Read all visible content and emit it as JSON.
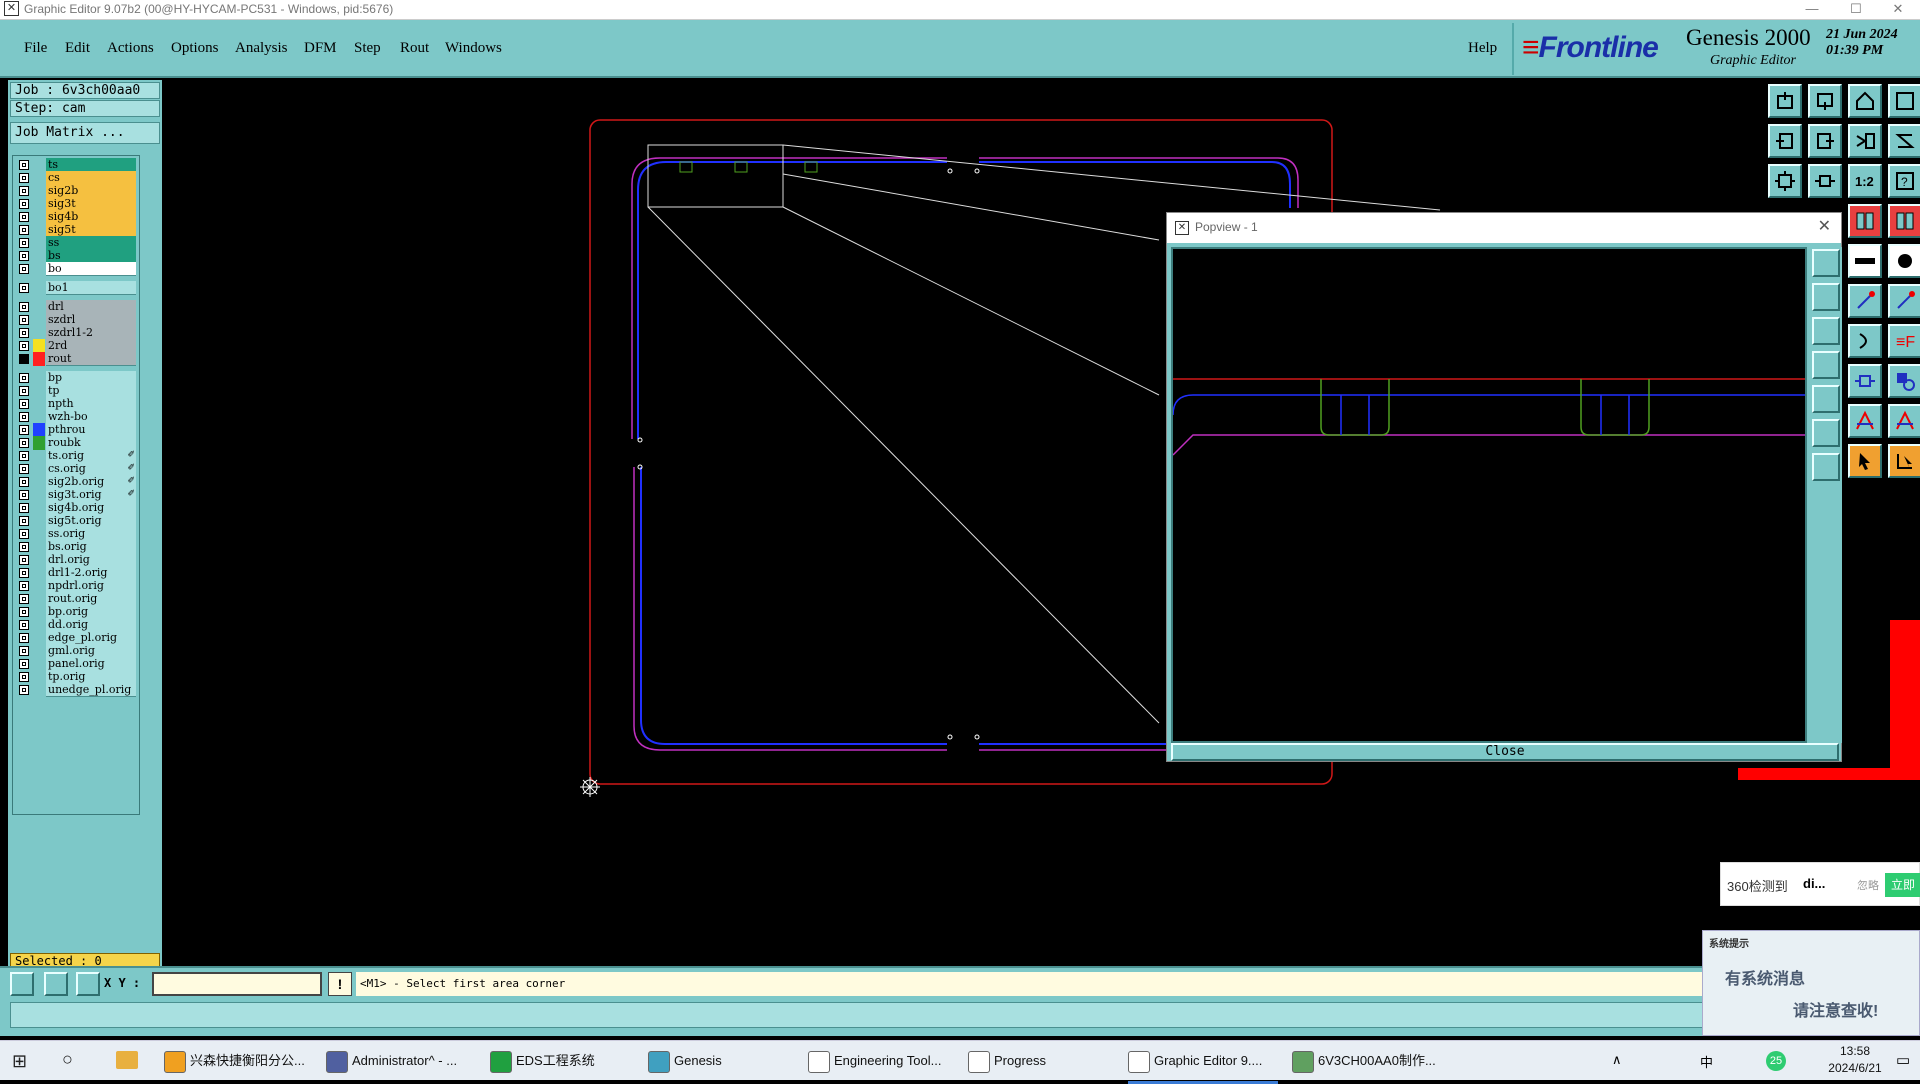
{
  "window": {
    "title": "Graphic Editor 9.07b2 (00@HY-HYCAM-PC531 - Windows, pid:5676)"
  },
  "menu": {
    "items": [
      "File",
      "Edit",
      "Actions",
      "Options",
      "Analysis",
      "DFM",
      "Step",
      "Rout",
      "Windows"
    ],
    "help": "Help"
  },
  "brand": {
    "logo": "Frontline",
    "product": "Genesis 2000",
    "subtitle": "Graphic Editor",
    "date": "21 Jun 2024",
    "time": "01:39 PM"
  },
  "job": {
    "job_label": "Job : 6v3ch00aa0",
    "step_label": "Step: cam",
    "matrix_button": "Job Matrix ..."
  },
  "layers": [
    {
      "name": "ts",
      "color": "#20a080",
      "swatch": ""
    },
    {
      "name": "cs",
      "color": "#f5c040",
      "swatch": ""
    },
    {
      "name": "sig2b",
      "color": "#f5c040",
      "swatch": ""
    },
    {
      "name": "sig3t",
      "color": "#f5c040",
      "swatch": ""
    },
    {
      "name": "sig4b",
      "color": "#f5c040",
      "swatch": ""
    },
    {
      "name": "sig5t",
      "color": "#f5c040",
      "swatch": ""
    },
    {
      "name": "ss",
      "color": "#20a080",
      "swatch": ""
    },
    {
      "name": "bs",
      "color": "#20a080",
      "swatch": ""
    },
    {
      "name": "bo",
      "color": "#ffffff",
      "swatch": ""
    },
    {
      "name": "bo1",
      "color": "#a8e0e0",
      "swatch": "",
      "gap": true
    },
    {
      "name": "drl",
      "color": "#a8b4b8",
      "swatch": "",
      "gap": true
    },
    {
      "name": "szdrl",
      "color": "#a8b4b8",
      "swatch": ""
    },
    {
      "name": "szdrl1-2",
      "color": "#a8b4b8",
      "swatch": ""
    },
    {
      "name": "2rd",
      "color": "#a8b4b8",
      "swatch": "#f5e020"
    },
    {
      "name": "rout",
      "color": "#a8b4b8",
      "swatch": "#ff2020",
      "active": true
    },
    {
      "name": "bp",
      "color": "#a8e0e0",
      "swatch": "",
      "gap": true
    },
    {
      "name": "tp",
      "color": "#a8e0e0",
      "swatch": ""
    },
    {
      "name": "npth",
      "color": "#a8e0e0",
      "swatch": ""
    },
    {
      "name": "wzh-bo",
      "color": "#a8e0e0",
      "swatch": ""
    },
    {
      "name": "pthrou",
      "color": "#a8e0e0",
      "swatch": "#2040ff"
    },
    {
      "name": "roubk",
      "color": "#a8e0e0",
      "swatch": "#30a030"
    },
    {
      "name": "ts.orig",
      "color": "#a8e0e0",
      "swatch": "",
      "mark": "✐"
    },
    {
      "name": "cs.orig",
      "color": "#a8e0e0",
      "swatch": "",
      "mark": "✐"
    },
    {
      "name": "sig2b.orig",
      "color": "#a8e0e0",
      "swatch": "",
      "mark": "✐"
    },
    {
      "name": "sig3t.orig",
      "color": "#a8e0e0",
      "swatch": "",
      "mark": "✐"
    },
    {
      "name": "sig4b.orig",
      "color": "#a8e0e0",
      "swatch": ""
    },
    {
      "name": "sig5t.orig",
      "color": "#a8e0e0",
      "swatch": ""
    },
    {
      "name": "ss.orig",
      "color": "#a8e0e0",
      "swatch": ""
    },
    {
      "name": "bs.orig",
      "color": "#a8e0e0",
      "swatch": ""
    },
    {
      "name": "drl.orig",
      "color": "#a8e0e0",
      "swatch": ""
    },
    {
      "name": "drl1-2.orig",
      "color": "#a8e0e0",
      "swatch": ""
    },
    {
      "name": "npdrl.orig",
      "color": "#a8e0e0",
      "swatch": ""
    },
    {
      "name": "rout.orig",
      "color": "#a8e0e0",
      "swatch": ""
    },
    {
      "name": "bp.orig",
      "color": "#a8e0e0",
      "swatch": ""
    },
    {
      "name": "dd.orig",
      "color": "#a8e0e0",
      "swatch": ""
    },
    {
      "name": "edge_pl.orig",
      "color": "#a8e0e0",
      "swatch": ""
    },
    {
      "name": "gml.orig",
      "color": "#a8e0e0",
      "swatch": ""
    },
    {
      "name": "panel.orig",
      "color": "#a8e0e0",
      "swatch": ""
    },
    {
      "name": "tp.orig",
      "color": "#a8e0e0",
      "swatch": ""
    },
    {
      "name": "unedge_pl.orig",
      "color": "#a8e0e0",
      "swatch": ""
    }
  ],
  "selected": "Selected : 0",
  "popview": {
    "title": "Popview - 1",
    "close_label": "Close"
  },
  "status": {
    "xy_label": "X Y :",
    "xy_value": "",
    "prompt": "<M1> - Select first area corner",
    "excl": "!"
  },
  "taskbar": {
    "items": [
      {
        "label": "兴森快捷衡阳分公...",
        "color": "#f0a020"
      },
      {
        "label": "Administrator^ - ...",
        "color": "#5060a0"
      },
      {
        "label": "EDS工程系统",
        "color": "#20a040"
      },
      {
        "label": "Genesis",
        "color": "#40a0c0"
      },
      {
        "label": "Engineering Tool...",
        "color": "#ffffff"
      },
      {
        "label": "Progress",
        "color": "#ffffff"
      },
      {
        "label": "Graphic Editor 9....",
        "color": "#ffffff"
      },
      {
        "label": "6V3CH00AA0制作...",
        "color": "#60a060"
      }
    ],
    "tray_ime": "中",
    "tray_temp": "25",
    "clock_time": "13:58",
    "clock_date": "2024/6/21"
  },
  "notification_360": {
    "text": "360检测到",
    "bold": "di...",
    "ignore": "忽略",
    "action": "立即"
  },
  "system_notice": {
    "title": "系统提示",
    "line1": "有系统消息",
    "line2": "请注意查收!"
  }
}
